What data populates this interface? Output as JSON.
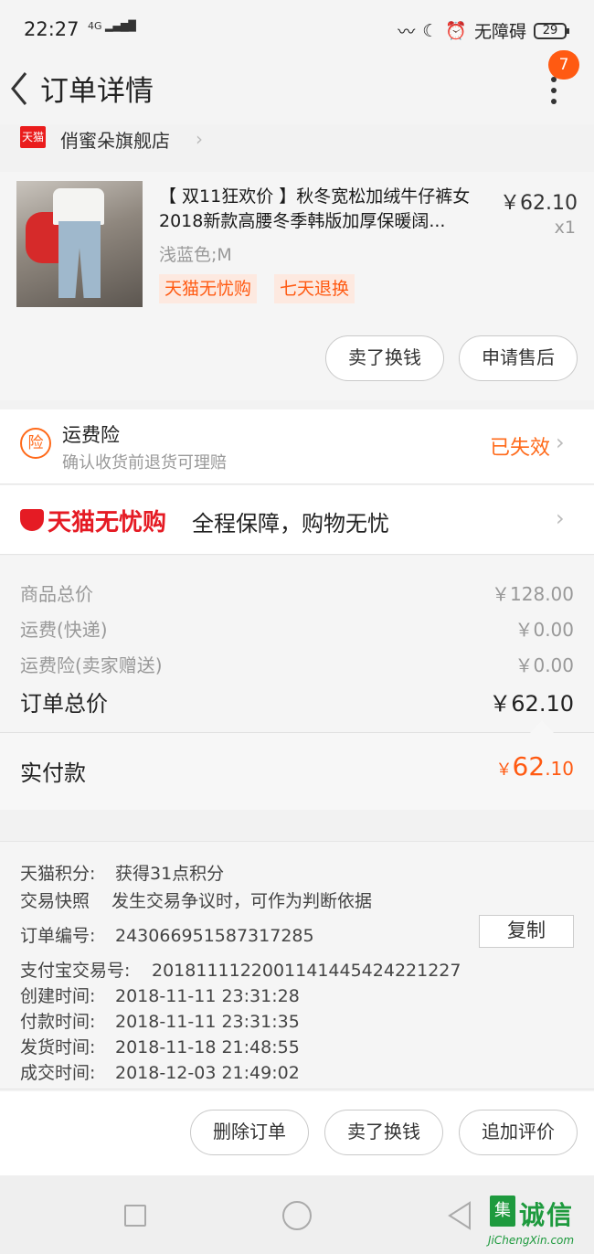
{
  "status_bar": {
    "time": "22:27",
    "signal": "4G",
    "accessibility": "无障碍",
    "battery": "29"
  },
  "header": {
    "title": "订单详情",
    "badge": "7"
  },
  "store": {
    "logo_text": "天猫",
    "name": "俏蜜朵旗舰店"
  },
  "product": {
    "title": "【 双11狂欢价 】秋冬宽松加绒牛仔裤女2018新款高腰冬季韩版加厚保暖阔...",
    "price": "￥62.10",
    "quantity": "x1",
    "sku": "浅蓝色;M",
    "tags": [
      "天猫无忧购",
      "七天退换"
    ],
    "buttons": {
      "sell": "卖了换钱",
      "after_sale": "申请售后"
    }
  },
  "insurance": {
    "icon_text": "险",
    "title": "运费险",
    "subtitle": "确认收货前退货可理赔",
    "status": "已失效"
  },
  "guarantee": {
    "brand": "天猫无忧购",
    "desc": "全程保障，购物无忧"
  },
  "totals": {
    "rows": [
      {
        "label": "商品总价",
        "value": "￥128.00"
      },
      {
        "label": "运费(快递)",
        "value": "￥0.00"
      },
      {
        "label": "运费险(卖家赠送)",
        "value": "￥0.00"
      }
    ],
    "order_total": {
      "label": "订单总价",
      "value": "￥62.10"
    }
  },
  "paid": {
    "label": "实付款",
    "currency": "￥",
    "integer": "62",
    "decimal": ".10"
  },
  "info": {
    "points": {
      "label": "天猫积分:",
      "value": "获得31点积分"
    },
    "snapshot": {
      "label": "交易快照",
      "value": "发生交易争议时，可作为判断依据"
    },
    "order_no": {
      "label": "订单编号:",
      "value": "243066951587317285"
    },
    "alipay_no": {
      "label": "支付宝交易号:",
      "value": "2018111122001141445424221227"
    },
    "created": {
      "label": "创建时间:",
      "value": "2018-11-11 23:31:28"
    },
    "paid": {
      "label": "付款时间:",
      "value": "2018-11-11 23:31:35"
    },
    "shipped": {
      "label": "发货时间:",
      "value": "2018-11-18 21:48:55"
    },
    "completed": {
      "label": "成交时间:",
      "value": "2018-12-03 21:49:02"
    },
    "copy_label": "复制"
  },
  "actions": {
    "delete": "删除订单",
    "sell": "卖了换钱",
    "review": "追加评价"
  },
  "watermark": {
    "cn": "诚信",
    "box": "集",
    "en": "JiChengXin.com"
  },
  "colors": {
    "accent": "#ff5a12",
    "tmall_red": "#e51b24"
  }
}
